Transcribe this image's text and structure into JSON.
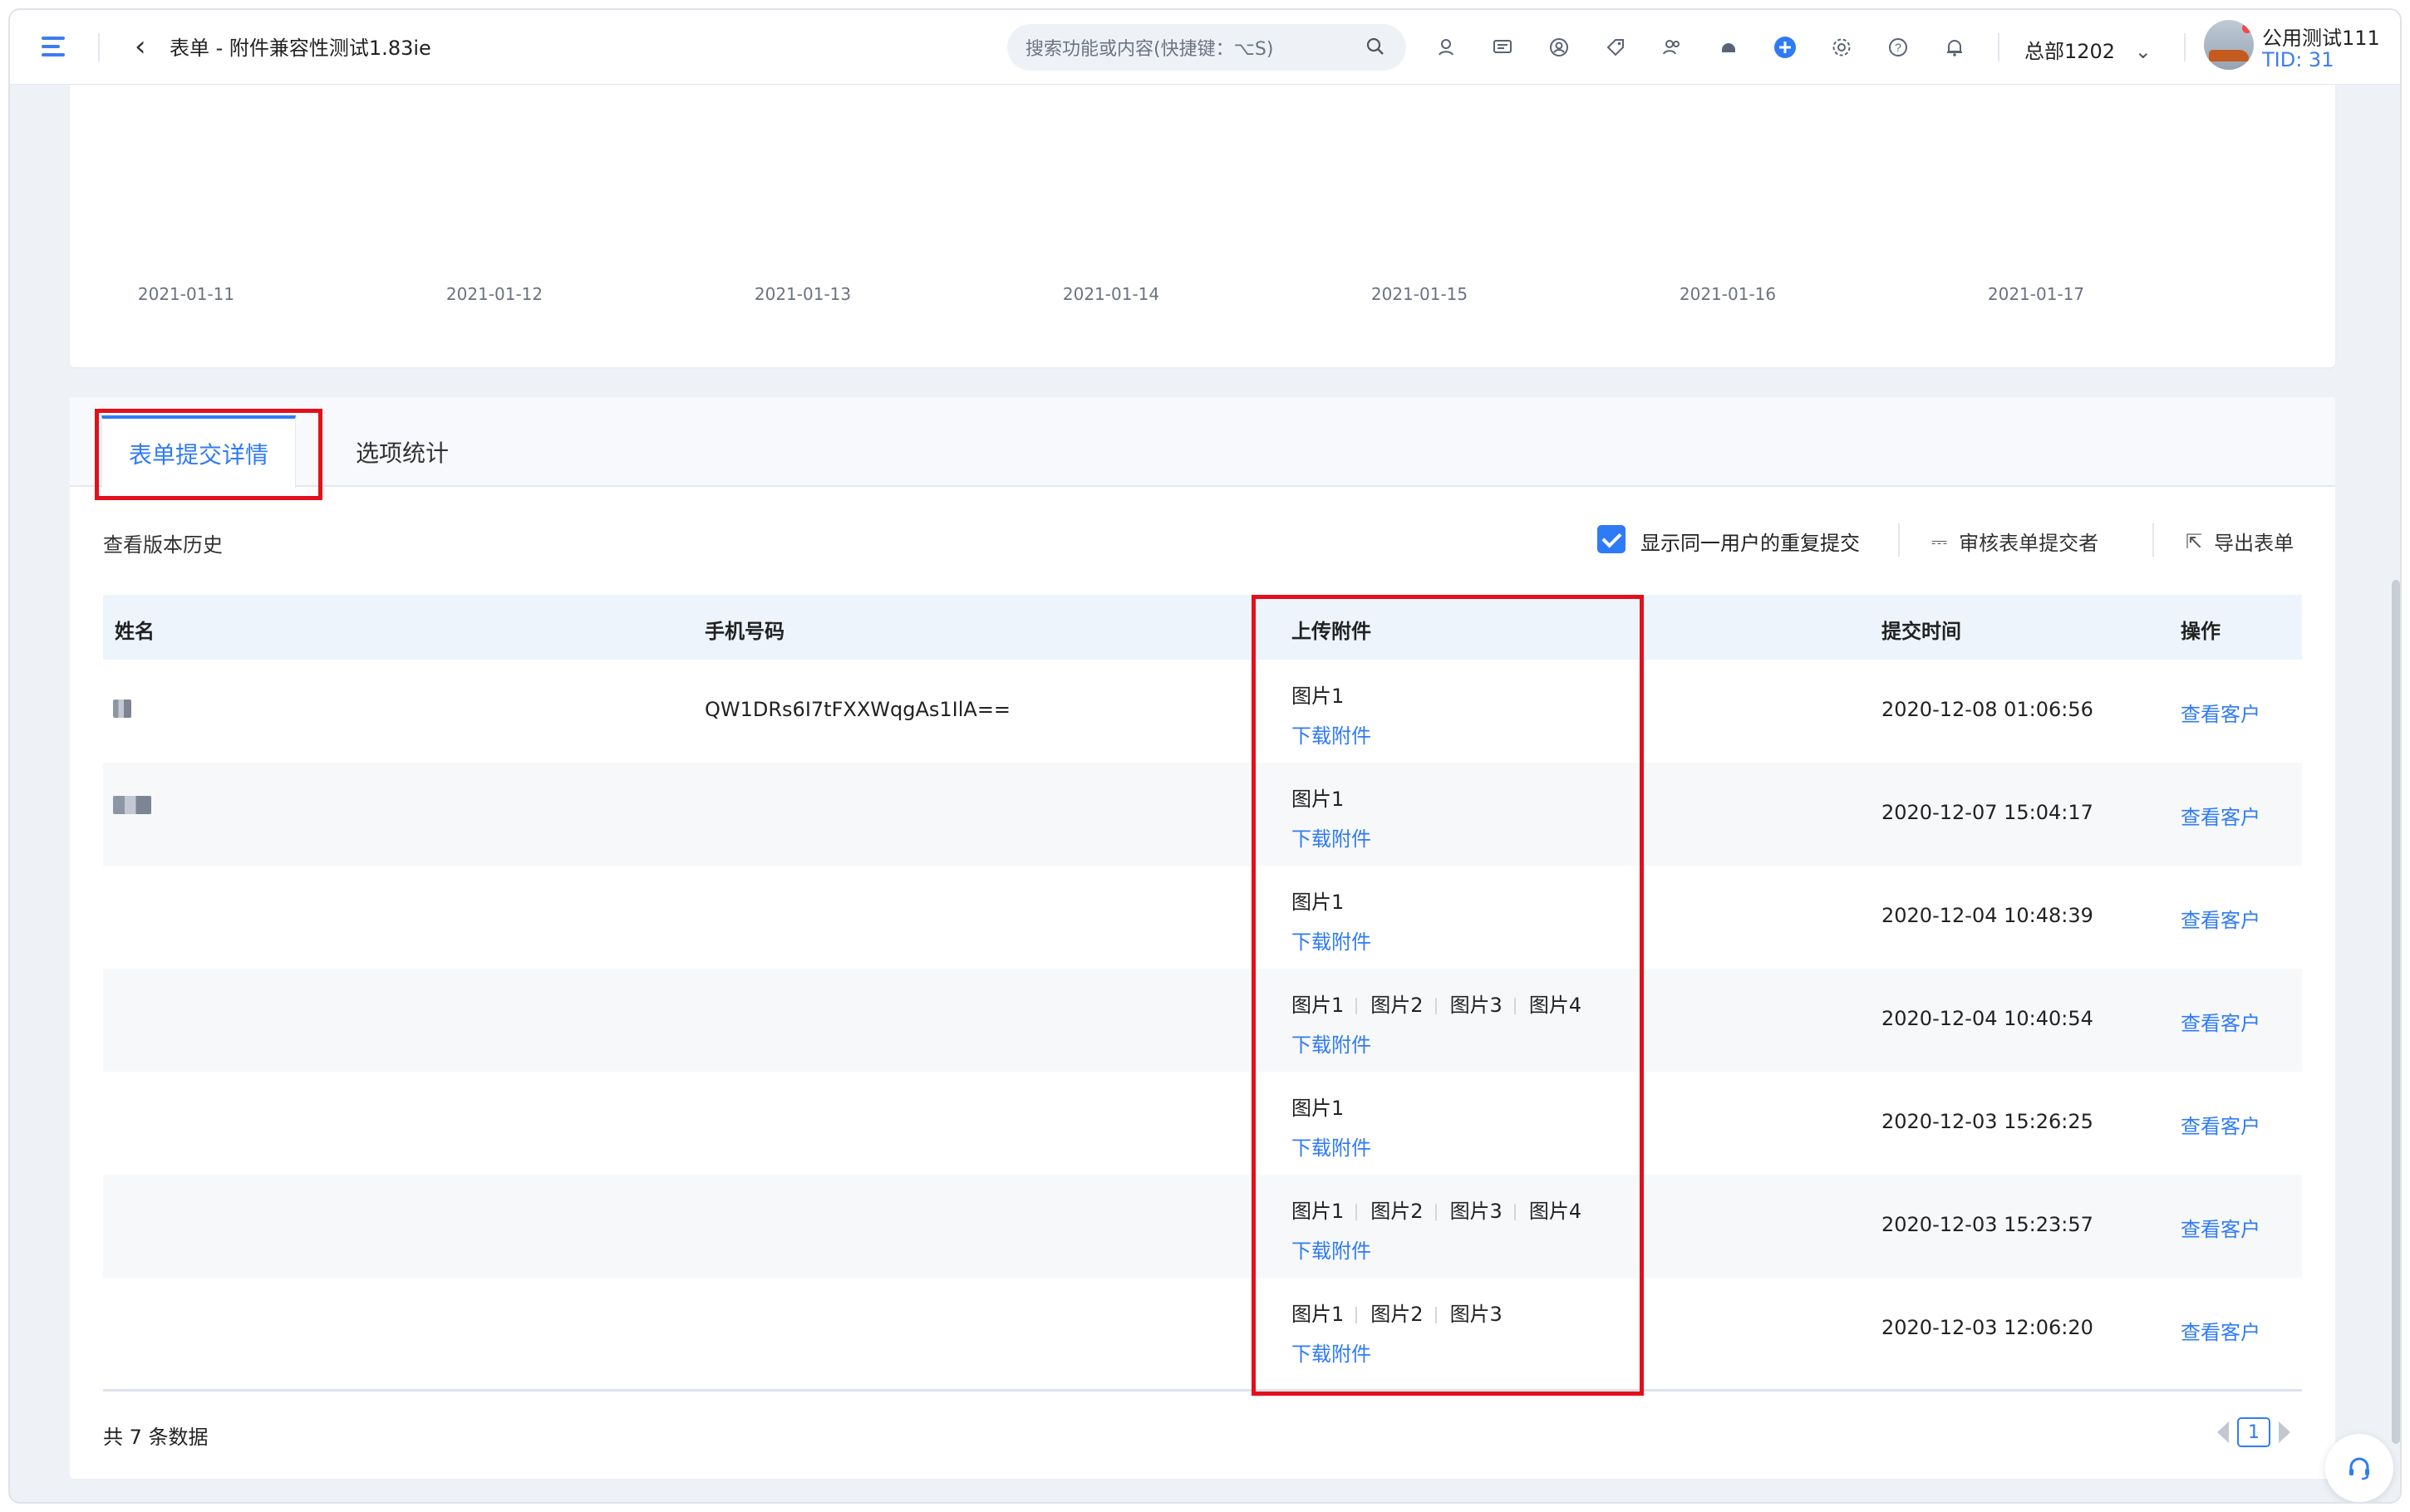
{
  "header": {
    "title": "表单 - 附件兼容性测试1.83ie",
    "search_placeholder": "搜索功能或内容(快捷键：⌥S)",
    "org": "总部1202",
    "user_name": "公用测试111",
    "tid": "TID: 31"
  },
  "chart_data": {
    "type": "line",
    "x": [
      "2021-01-11",
      "2021-01-12",
      "2021-01-13",
      "2021-01-14",
      "2021-01-15",
      "2021-01-16",
      "2021-01-17"
    ]
  },
  "tabs": [
    {
      "label": "表单提交详情"
    },
    {
      "label": "选项统计"
    }
  ],
  "toolbar": {
    "history": "查看版本历史",
    "show_repeat": "显示同一用户的重复提交",
    "review": "审核表单提交者",
    "export": "导出表单"
  },
  "table": {
    "columns": [
      "姓名",
      "手机号码",
      "上传附件",
      "提交时间",
      "操作"
    ],
    "rows": [
      {
        "phone": "QW1DRs6I7tFXXWqgAs1IlA==",
        "files": [
          "图片1"
        ],
        "download": "下载附件",
        "time": "2020-12-08 01:06:56",
        "action": "查看客户"
      },
      {
        "phone": "",
        "files": [
          "图片1"
        ],
        "download": "下载附件",
        "time": "2020-12-07 15:04:17",
        "action": "查看客户"
      },
      {
        "phone": "",
        "files": [
          "图片1"
        ],
        "download": "下载附件",
        "time": "2020-12-04 10:48:39",
        "action": "查看客户"
      },
      {
        "phone": "",
        "files": [
          "图片1",
          "图片2",
          "图片3",
          "图片4"
        ],
        "download": "下载附件",
        "time": "2020-12-04 10:40:54",
        "action": "查看客户"
      },
      {
        "phone": "",
        "files": [
          "图片1"
        ],
        "download": "下载附件",
        "time": "2020-12-03 15:26:25",
        "action": "查看客户"
      },
      {
        "phone": "",
        "files": [
          "图片1",
          "图片2",
          "图片3",
          "图片4"
        ],
        "download": "下载附件",
        "time": "2020-12-03 15:23:57",
        "action": "查看客户"
      },
      {
        "phone": "",
        "files": [
          "图片1",
          "图片2",
          "图片3"
        ],
        "download": "下载附件",
        "time": "2020-12-03 12:06:20",
        "action": "查看客户"
      }
    ]
  },
  "footer": {
    "total": "共 7 条数据",
    "page": "1"
  },
  "colors": {
    "accent": "#2f7bf5",
    "highlight": "#e3101c"
  }
}
